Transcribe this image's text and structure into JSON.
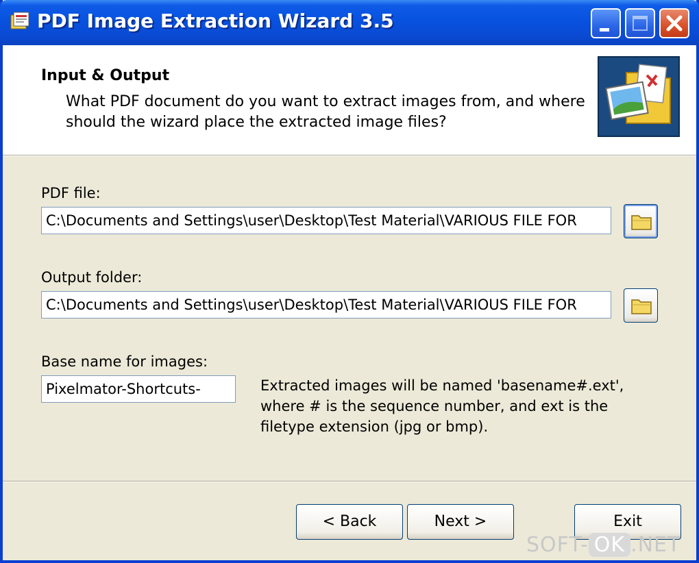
{
  "window": {
    "title": "PDF Image Extraction Wizard 3.5",
    "icons": {
      "app": "app-icon",
      "minimize": "minimize-icon",
      "maximize": "maximize-icon",
      "close": "close-icon"
    }
  },
  "header": {
    "title": "Input & Output",
    "description": "What PDF document do you want to extract images from, and where should the wizard place the extracted image files?",
    "image_icon": "pdf-folder-image-icon"
  },
  "pdf_file": {
    "label": "PDF file:",
    "value": "C:\\Documents and Settings\\user\\Desktop\\Test Material\\VARIOUS FILE FOR",
    "browse_icon": "folder-icon"
  },
  "output_folder": {
    "label": "Output folder:",
    "value": "C:\\Documents and Settings\\user\\Desktop\\Test Material\\VARIOUS FILE FOR",
    "browse_icon": "folder-icon"
  },
  "base_name": {
    "label": "Base name for images:",
    "value": "Pixelmator-Shortcuts-",
    "hint": "Extracted images will be named 'basename#.ext', where # is the sequence number, and ext is the filetype extension (jpg or bmp)."
  },
  "buttons": {
    "back": "< Back",
    "next": "Next >",
    "exit": "Exit"
  },
  "watermark": {
    "left": "SOFT-",
    "middle": "OK",
    "right": ".NET"
  },
  "colors": {
    "titlebar": "#0a4ad2",
    "dialog_bg": "#ece9d8",
    "close_button": "#d9512b",
    "field_border": "#7f9db9"
  }
}
